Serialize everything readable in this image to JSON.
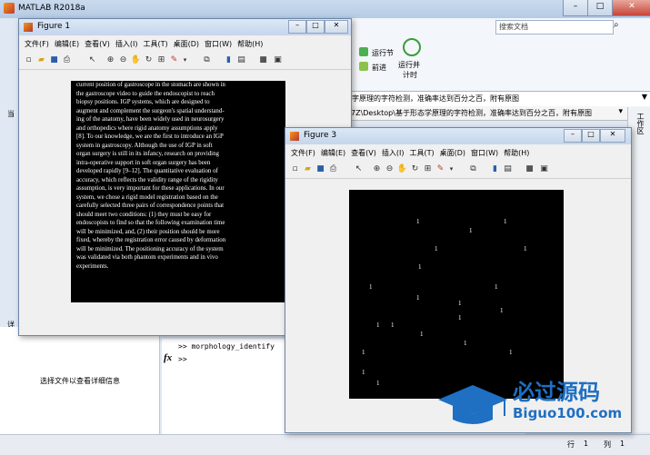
{
  "app": {
    "title": "MATLAB R2018a",
    "search_placeholder": "搜索文档",
    "ribbon": {
      "run_section": "运行节",
      "advance": "前进",
      "run_timed_line1": "运行并",
      "run_timed_line2": "计时"
    },
    "path_dropdown": "字原理的字符检测，准确率达到百分之百，附有原图",
    "path_bar": "7Z\\Desktop\\基于形态学原理的字符检测，准确率达到百分之百，附有原图",
    "details_text": "选择文件以查看详细信息",
    "command_history": ">> morphology_identify",
    "prompt": ">>",
    "fx_symbol": "fx",
    "status_row_label": "行",
    "status_row_value": "1",
    "status_col_label": "列",
    "status_col_value": "1",
    "left_labels": {
      "a": "当",
      "b": "详"
    }
  },
  "figure1": {
    "title": "Figure 1",
    "menus": [
      "文件(F)",
      "编辑(E)",
      "查看(V)",
      "插入(I)",
      "工具(T)",
      "桌面(D)",
      "窗口(W)",
      "帮助(H)"
    ],
    "paper_lines": [
      "current position of gastroscope in the stomach are shown in",
      "the gastroscope video to guide the endoscopist to reach",
      "biopsy positions. IGP systems, which are designed to",
      "augment and complement the surgeon's spatial understand-",
      "ing of the anatomy, have been widely used in neurosurgery",
      "and orthopedics where rigid anatomy assumptions apply",
      "[8]. To our knowledge, we are the first to introduce an IGP",
      "system in gastroscopy. Although the use of IGP in soft",
      "organ surgery is still in its infancy, research on providing",
      "intra-operative support in soft organ surgery has been",
      "developed rapidly [9–12]. The quantitative evaluation of",
      "accuracy, which reflects the validity range of the rigidity",
      "assumption, is very important for these applications. In our",
      "system, we chose a rigid model registration based on the",
      "carefully selected three pairs of correspondence points that",
      "should meet two conditions: (1) they must be easy for",
      "endoscopists to find so that the following examination time",
      "will be minimized, and, (2) their position should be more",
      "fixed, whereby the registration error caused by deformation",
      "will be minimized. The positioning accuracy of the system",
      "was validated via both phantom experiments and in vivo",
      "experiments."
    ]
  },
  "figure3": {
    "title": "Figure 3",
    "menus": [
      "文件(F)",
      "编辑(E)",
      "查看(V)",
      "插入(I)",
      "工具(T)",
      "桌面(D)",
      "窗口(W)",
      "帮助(H)"
    ]
  },
  "watermark": {
    "brand": "必过源码",
    "url": "Biguo100.com"
  },
  "colors": {
    "figure_bg": "#000000",
    "titlebar": "#c4d6ec",
    "accent": "#2a78c8"
  }
}
